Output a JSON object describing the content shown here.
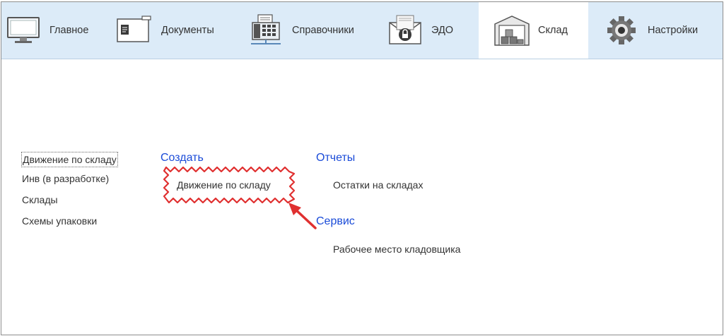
{
  "nav": {
    "tabs": [
      {
        "label": "Главное",
        "icon": "monitor-icon",
        "active": false
      },
      {
        "label": "Документы",
        "icon": "documents-icon",
        "active": false
      },
      {
        "label": "Справочники",
        "icon": "fax-directory-icon",
        "active": false
      },
      {
        "label": "ЭДО",
        "icon": "mail-lock-icon",
        "active": false
      },
      {
        "label": "Склад",
        "icon": "warehouse-icon",
        "active": true
      },
      {
        "label": "Настройки",
        "icon": "gear-icon",
        "active": false
      }
    ]
  },
  "sections": {
    "items": [
      {
        "label": "Движение по складу",
        "selected": true
      },
      {
        "label": "Инв (в разработке)",
        "selected": false
      },
      {
        "label": "Склады",
        "selected": false
      },
      {
        "label": "Схемы упаковки",
        "selected": false
      }
    ]
  },
  "groups": {
    "create": {
      "title": "Создать",
      "commands": [
        "Движение по складу"
      ]
    },
    "reports": {
      "title": "Отчеты",
      "commands": [
        "Остатки на складах"
      ]
    },
    "service": {
      "title": "Сервис",
      "commands": [
        "Рабочее место кладовщика"
      ]
    }
  },
  "colors": {
    "topbar_bg": "#dcebf8",
    "group_title": "#1a4bd8",
    "annotation": "#e03030"
  }
}
